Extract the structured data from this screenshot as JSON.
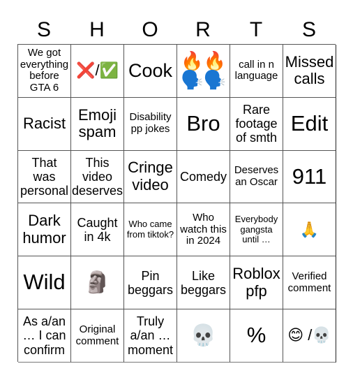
{
  "title_letters": [
    "S",
    "H",
    "O",
    "R",
    "T",
    "S"
  ],
  "cells": [
    {
      "text": "We got everything before GTA 6",
      "size": "fs-s"
    },
    {
      "text": "❌/✅",
      "size": "emoji"
    },
    {
      "text": "Cook",
      "size": "fs-xl"
    },
    {
      "text": "🔥🔥 🗣️🗣️",
      "size": "emoji-stack"
    },
    {
      "text": "call in n language",
      "size": "fs-s"
    },
    {
      "text": "Missed calls",
      "size": "fs-l"
    },
    {
      "text": "Racist",
      "size": "fs-l"
    },
    {
      "text": "Emoji spam",
      "size": "fs-l"
    },
    {
      "text": "Disability pp jokes",
      "size": "fs-s"
    },
    {
      "text": "Bro",
      "size": "fs-xxl"
    },
    {
      "text": "Rare footage of smth",
      "size": "fs-m"
    },
    {
      "text": "Edit",
      "size": "fs-xxl"
    },
    {
      "text": "That was personal",
      "size": "fs-m"
    },
    {
      "text": "This video deserves",
      "size": "fs-m"
    },
    {
      "text": "Cringe video",
      "size": "fs-l"
    },
    {
      "text": "Comedy",
      "size": "fs-m"
    },
    {
      "text": "Deserves an Oscar",
      "size": "fs-s"
    },
    {
      "text": "911",
      "size": "fs-xxl"
    },
    {
      "text": "Dark humor",
      "size": "fs-l"
    },
    {
      "text": "Caught in 4k",
      "size": "fs-m"
    },
    {
      "text": "Who came from tiktok?",
      "size": "fs-xs"
    },
    {
      "text": "Who watch this in 2024",
      "size": "fs-s"
    },
    {
      "text": "Everybody gangsta until …",
      "size": "fs-xs"
    },
    {
      "text": "🙏",
      "size": "emoji"
    },
    {
      "text": "Wild",
      "size": "fs-xxl"
    },
    {
      "text": "🗿",
      "size": "emoji-big"
    },
    {
      "text": "Pin beggars",
      "size": "fs-m"
    },
    {
      "text": "Like beggars",
      "size": "fs-m"
    },
    {
      "text": "Roblox pfp",
      "size": "fs-l"
    },
    {
      "text": "Verified comment",
      "size": "fs-s"
    },
    {
      "text": "As a/an … I can confirm",
      "size": "fs-m"
    },
    {
      "text": "Original comment",
      "size": "fs-s"
    },
    {
      "text": "Truly a/an … moment",
      "size": "fs-m"
    },
    {
      "text": "💀",
      "size": "emoji-big"
    },
    {
      "text": "%",
      "size": "fs-xxl"
    },
    {
      "text": "😊 /💀",
      "size": "emoji"
    }
  ]
}
